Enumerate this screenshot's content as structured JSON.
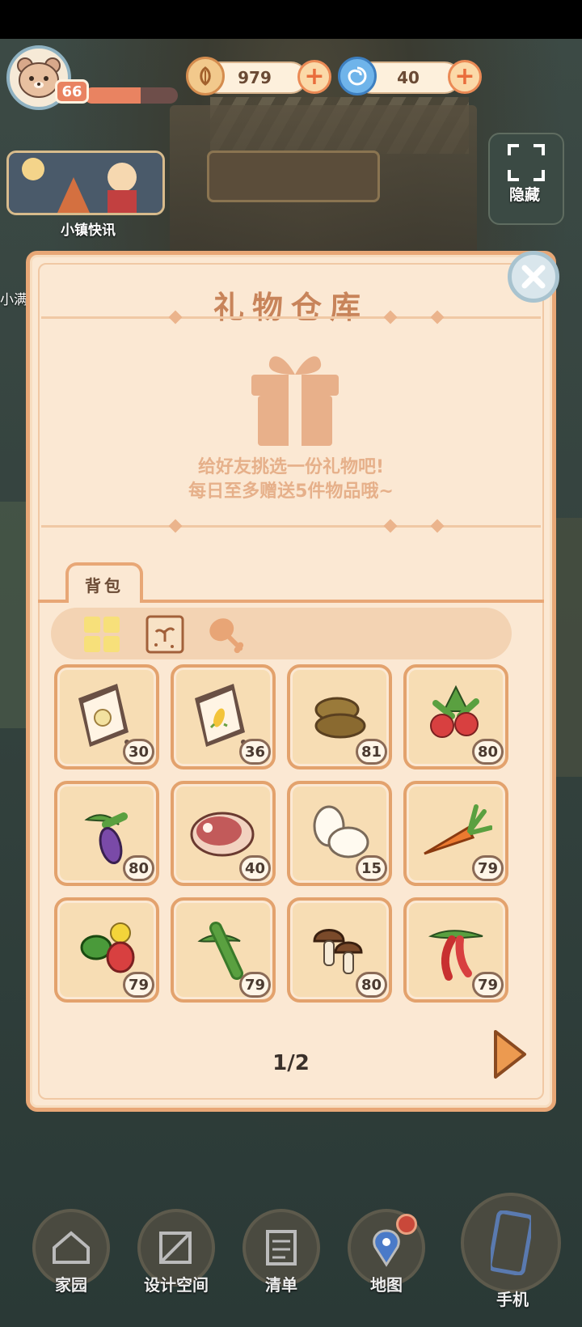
{
  "hud": {
    "level": "66",
    "xp_fraction": 0.6,
    "currency1": {
      "value": "979",
      "icon": "leaf-coin-icon"
    },
    "currency2": {
      "value": "40",
      "icon": "blue-swirl-gem-icon"
    }
  },
  "side": {
    "news_label": "小镇快讯",
    "left_partial_label": "小满",
    "hide_label": "隐藏"
  },
  "panel": {
    "title": "礼物仓库",
    "hint_line1": "给好友挑选一份礼物吧!",
    "hint_line2": "每日至多赠送5件物品哦~",
    "tab_label": "背包",
    "filters": [
      "all-grid-icon",
      "seed-packet-icon",
      "drumstick-icon"
    ],
    "items": [
      {
        "name": "cabbage-seed-packet",
        "count": "30"
      },
      {
        "name": "corn-seed-packet",
        "count": "36"
      },
      {
        "name": "potato",
        "count": "81"
      },
      {
        "name": "strawberry",
        "count": "80"
      },
      {
        "name": "eggplant",
        "count": "80"
      },
      {
        "name": "meat",
        "count": "40"
      },
      {
        "name": "eggs",
        "count": "15"
      },
      {
        "name": "carrot",
        "count": "79"
      },
      {
        "name": "pepper",
        "count": "79"
      },
      {
        "name": "cucumber",
        "count": "79"
      },
      {
        "name": "mushroom",
        "count": "80"
      },
      {
        "name": "chili",
        "count": "79"
      }
    ],
    "page": "1/2"
  },
  "nav": {
    "home": "家园",
    "design": "设计空间",
    "list": "清单",
    "map": "地图",
    "phone": "手机"
  },
  "colors": {
    "panel_bg": "#fbe8d3",
    "panel_border": "#e8a776",
    "title": "#c8845a",
    "accent": "#e98361"
  }
}
